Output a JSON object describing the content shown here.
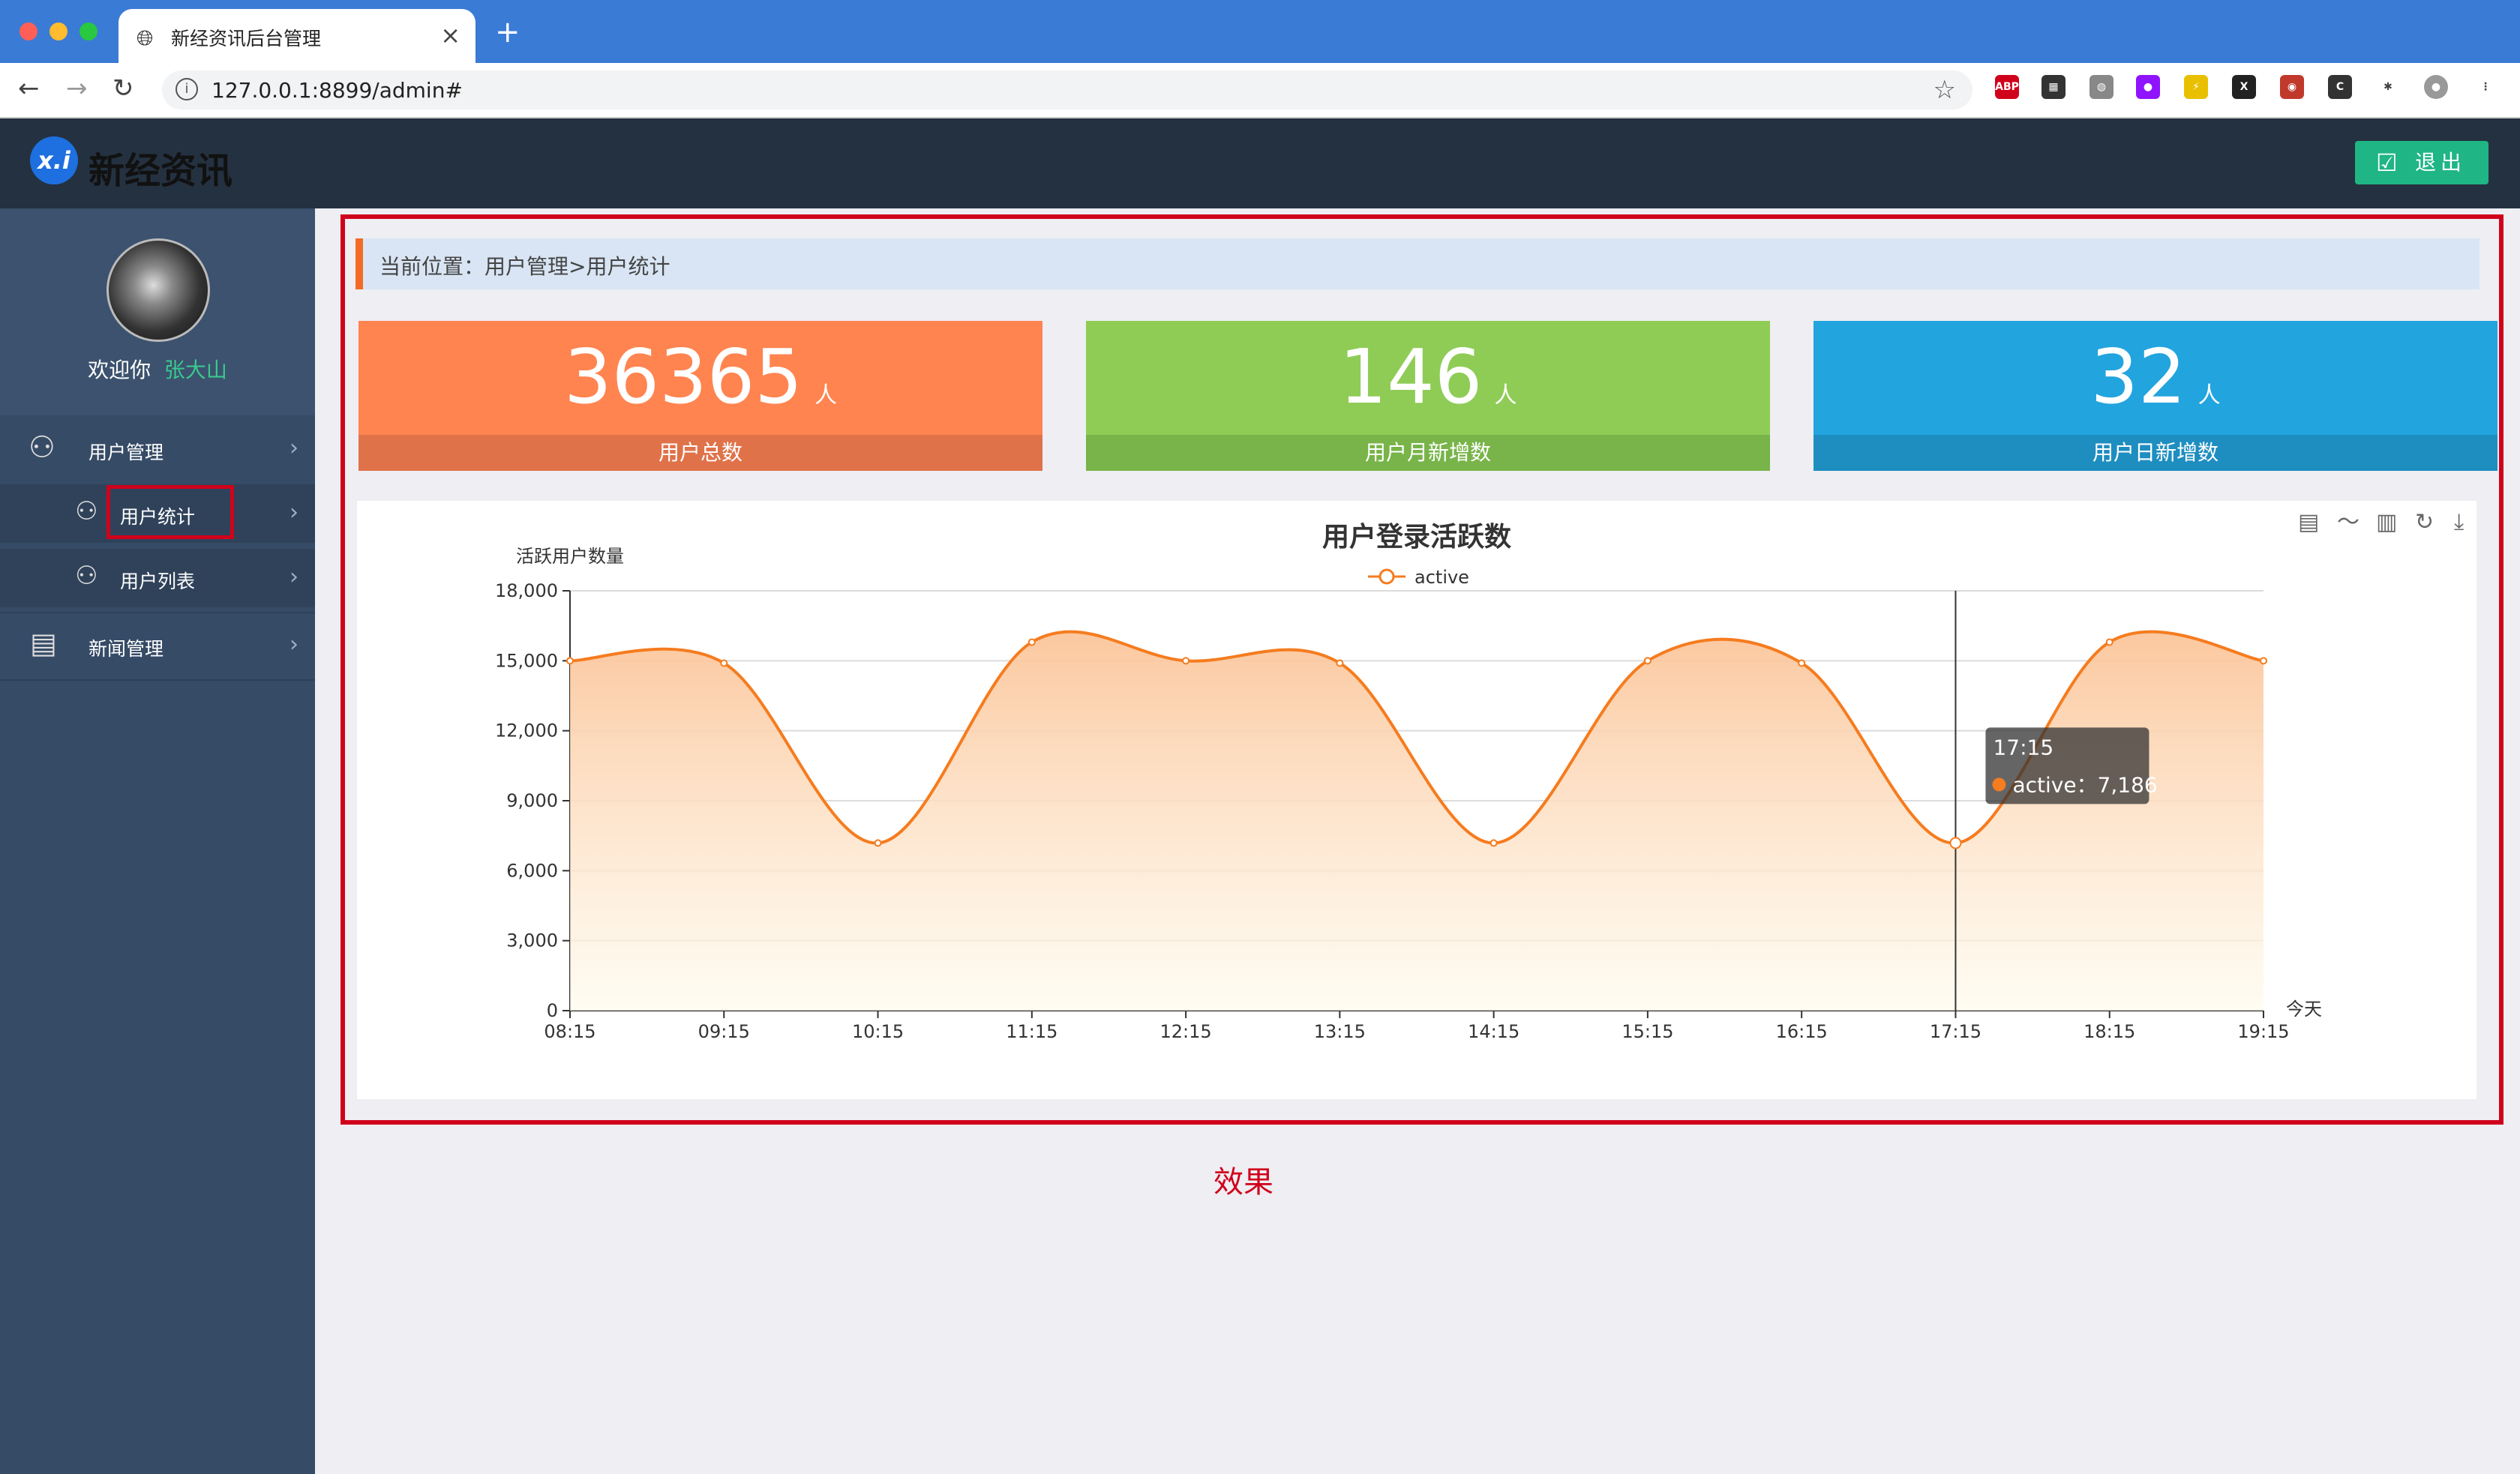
{
  "browser": {
    "tab_title": "新经资讯后台管理",
    "tab_close": "×",
    "new_tab": "+",
    "url": "127.0.0.1:8899/admin#",
    "extensions": [
      {
        "name": "abp-extension-icon",
        "text": "ABP",
        "color": "#d0021b"
      },
      {
        "name": "qr-extension-icon",
        "text": "▦",
        "color": "#333333"
      },
      {
        "name": "globe-extension-icon",
        "text": "◍",
        "color": "#888888"
      },
      {
        "name": "purple-extension-icon",
        "text": "●",
        "color": "#9013fe"
      },
      {
        "name": "lightning-extension-icon",
        "text": "⚡",
        "color": "#e8c000"
      },
      {
        "name": "x-extension-icon",
        "text": "X",
        "color": "#222222"
      },
      {
        "name": "flag-extension-icon",
        "text": "◉",
        "color": "#c0392b"
      },
      {
        "name": "c-extension-icon",
        "text": "C",
        "color": "#333333"
      },
      {
        "name": "puzzle-extension-icon",
        "text": "✱",
        "color": "#444444"
      },
      {
        "name": "profile-icon",
        "text": "●",
        "color": "#999999"
      },
      {
        "name": "more-icon",
        "text": "⋮",
        "color": "#444444"
      }
    ]
  },
  "header": {
    "logo_badge": "x.i",
    "logo_text": "新经资讯",
    "logout_label": "退出"
  },
  "sidebar": {
    "welcome": "欢迎你",
    "username": "张大山",
    "menu": [
      {
        "label": "用户管理"
      },
      {
        "label": "用户统计"
      },
      {
        "label": "用户列表"
      },
      {
        "label": "新闻管理"
      }
    ]
  },
  "main": {
    "breadcrumb": "当前位置：用户管理>用户统计",
    "stats": [
      {
        "value": "36365",
        "unit": "人",
        "label": "用户总数",
        "color": "#ff8450",
        "bar_color": "#e0724a"
      },
      {
        "value": "146",
        "unit": "人",
        "label": "用户月新增数",
        "color": "#8fcc56",
        "bar_color": "#78b449"
      },
      {
        "value": "32",
        "unit": "人",
        "label": "用户日新增数",
        "color": "#22a4de",
        "bar_color": "#1e8ec0"
      }
    ],
    "effect_label": "效果"
  },
  "chart_data": {
    "type": "area",
    "title": "用户登录活跃数",
    "ylabel": "活跃用户数量",
    "xlabel": "今天",
    "legend": [
      "active"
    ],
    "legend_position": "top-center",
    "categories": [
      "08:15",
      "09:15",
      "10:15",
      "11:15",
      "12:15",
      "13:15",
      "14:15",
      "15:15",
      "16:15",
      "17:15",
      "18:15",
      "19:15"
    ],
    "series": [
      {
        "name": "active",
        "values": [
          15000,
          14900,
          7186,
          15800,
          15000,
          14900,
          7186,
          15000,
          14900,
          7186,
          15800,
          15000
        ],
        "color": "#f57c1f"
      }
    ],
    "ylim": [
      0,
      18000
    ],
    "yticks": [
      "0",
      "3,000",
      "6,000",
      "9,000",
      "12,000",
      "15,000",
      "18,000"
    ],
    "grid": true,
    "tooltip": {
      "title": "17:15",
      "text": "active：7,186",
      "index": 9
    }
  }
}
